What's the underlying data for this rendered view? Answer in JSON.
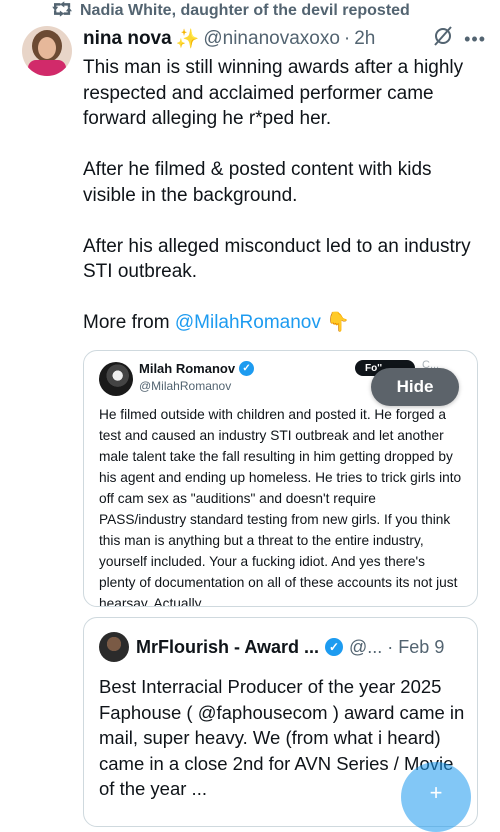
{
  "repost": {
    "icon": "repost-icon",
    "text": "Nadia White, daughter of the devil reposted"
  },
  "post": {
    "author_name": "nina nova",
    "author_emoji": "✨",
    "handle": "@ninanovaxoxo",
    "separator": "·",
    "time": "2h",
    "grok_icon": "grok-icon",
    "more_icon": "more-icon",
    "body": "This man is still winning awards after a highly respected and acclaimed performer came forward alleging he r*ped her.\n\nAfter he filmed & posted content with kids visible in the background.\n\nAfter his alleged misconduct led to an industry STI outbreak.",
    "more_prefix": "More from",
    "more_mention": "@MilahRomanov",
    "more_emoji": "👇"
  },
  "quote1": {
    "name": "Milah Romanov",
    "handle": "@MilahRomanov",
    "follow_label": "Fo''",
    "follow_extra": "C...",
    "hide_label": "Hide",
    "text": "He filmed outside with children and posted it. He forged a test and caused an industry STI outbreak and let another male talent take the fall resulting in him getting dropped by his agent and ending up homeless. He tries to trick girls into off cam sex as \"auditions\" and doesn't require PASS/industry standard testing from new girls. If you think this man is anything but a threat to the entire industry, yourself included. Your a fucking idiot. And yes there's plenty of documentation on all of these accounts its not just hearsay. Actually,"
  },
  "quote2": {
    "name": "MrFlourish - Award ...",
    "handle": "@... ·",
    "date": "Feb 9",
    "text": "Best Interracial Producer of the year 2025 Faphouse ( @faphousecom ) award came in mail, super heavy. We (from what i heard) came in a close 2nd for AVN Series / Movie of the year ..."
  },
  "fab": {
    "icon": "compose-post-icon",
    "glyph": "+"
  },
  "colors": {
    "accent": "#1d9bf0",
    "text": "#0f1419",
    "muted": "#536471",
    "border": "#cfd9de"
  }
}
